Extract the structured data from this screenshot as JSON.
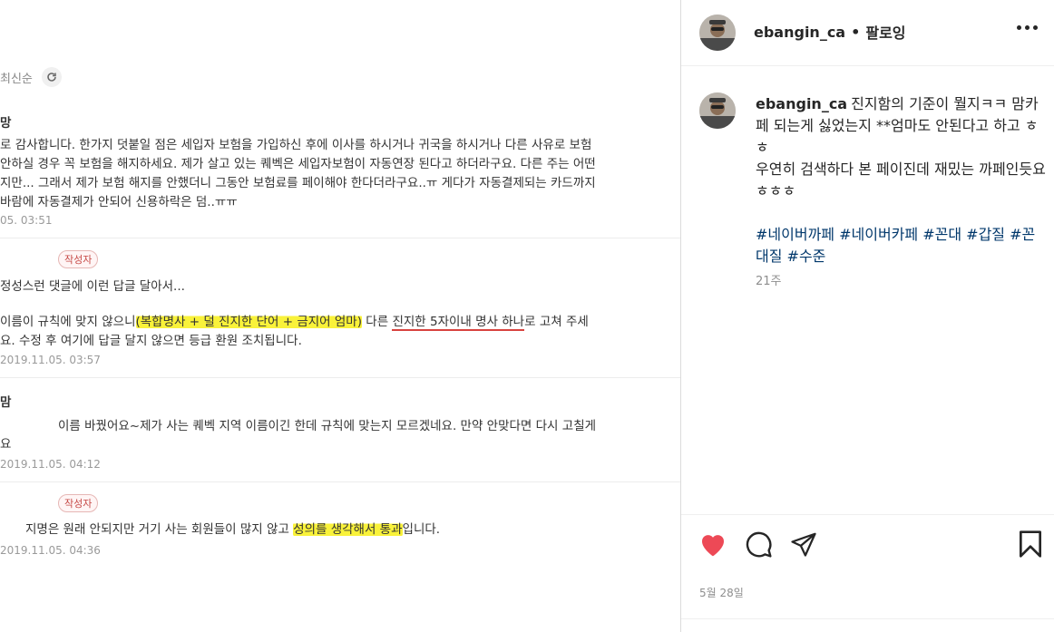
{
  "photo": {
    "sort_label": "최신순",
    "comments": [
      {
        "author": "망",
        "lines": [
          "로 감사합니다. 한가지 덧붙일 점은 세입자 보험을 가입하신 후에 이사를 하시거나 귀국을 하시거나 다른 사유로 보험",
          "안하실 경우 꼭 보험을 해지하세요. 제가 살고 있는 퀘벡은 세입자보험이 자동연장 된다고 하더라구요. 다른 주는 어떤",
          "지만... 그래서 제가 보험 해지를 안했더니 그동안 보험료를 페이해야 한다더라구요..ㅠ 게다가 자동결제되는 카드까지",
          "바람에 자동결제가 안되어 신용하락은 덤..ㅠㅠ"
        ],
        "date": "05. 03:51"
      },
      {
        "badge": "작성자",
        "line1": "정성스런 댓글에 이런 답글 달아서...",
        "line2_pre": "이름이 규칙에 맞지 않으니",
        "line2_hl": "(복합명사 + 덜 진지한 단어 + 금지어 엄마)",
        "line2_mid": " 다른 ",
        "line2_ul": "진지한 5자이내 명사 하나",
        "line2_post": "로 고쳐 주세",
        "line3": "요. 수정 후 여기에 답글 달지 않으면 등급 환원 조치됩니다.",
        "date": "2019.11.05. 03:57"
      },
      {
        "author": "맘",
        "line1": "이름 바꿨어요~제가 사는 퀘벡 지역 이름이긴 한데 규칙에 맞는지 모르겠네요. 만약 안맞다면 다시 고칠게",
        "line2": "요",
        "date": "2019.11.05. 04:12"
      },
      {
        "badge": "작성자",
        "line_pre": "지명은 원래 안되지만 거기 사는 회원들이 많지 않고 ",
        "line_hl": "성의를 생각해서 통과",
        "line_post": "입니다.",
        "date": "2019.11.05. 04:36"
      }
    ]
  },
  "header": {
    "username": "ebangin_ca",
    "dot": "•",
    "follow": "팔로잉"
  },
  "caption": {
    "username": "ebangin_ca",
    "text": "진지함의 기준이 뭘지ㅋㅋ 맘카페 되는게 싫었는지 **엄마도 안된다고 하고 ㅎㅎ\n우연히 검색하다 본 페이진데 재밌는 까페인듯요ㅎㅎㅎ\n\n",
    "hashtags": [
      "#네이버까페",
      "#네이버카페",
      "#꼰대",
      "#갑질",
      "#꼰대질",
      "#수준"
    ],
    "time": "21주"
  },
  "footer": {
    "date": "5월 28일"
  },
  "icons": {
    "like": "heart-filled-icon",
    "comment": "comment-bubble-icon",
    "share": "paper-plane-icon",
    "save": "bookmark-icon",
    "more": "more-dots-icon",
    "refresh": "refresh-icon"
  },
  "colors": {
    "like": "#ed4956",
    "hashtag": "#00376b",
    "highlight": "#f9f23a",
    "badge": "#c64a47"
  }
}
